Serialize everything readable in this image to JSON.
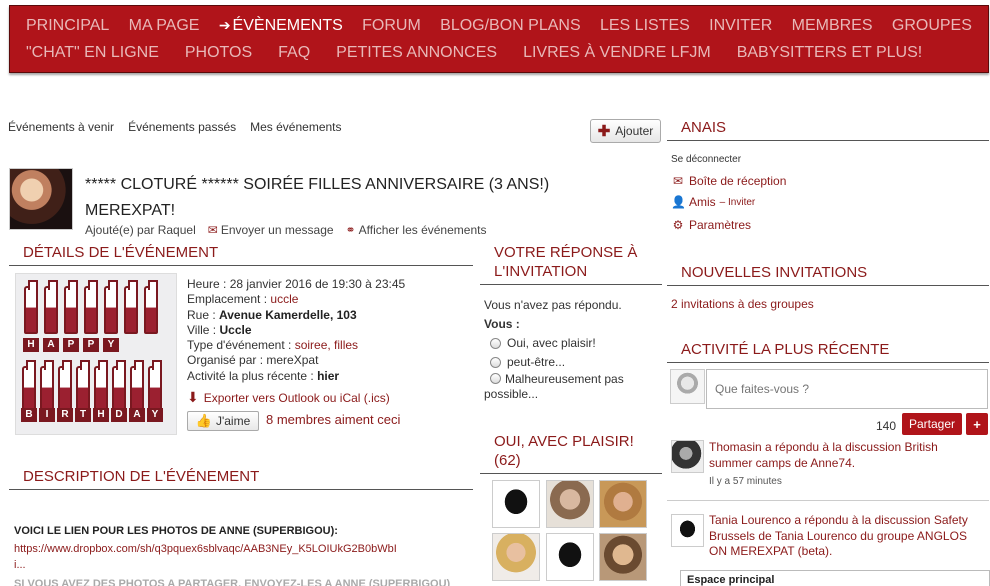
{
  "nav": {
    "row1": [
      {
        "label": "PRINCIPAL",
        "active": false
      },
      {
        "label": "MA PAGE",
        "active": false
      },
      {
        "label": "ÉVÈNEMENTS",
        "active": true
      },
      {
        "label": "FORUM",
        "active": false
      },
      {
        "label": "BLOG/BON PLANS",
        "active": false
      },
      {
        "label": "LES LISTES",
        "active": false
      },
      {
        "label": "INVITER",
        "active": false
      },
      {
        "label": "MEMBRES",
        "active": false
      },
      {
        "label": "GROUPES",
        "active": false
      }
    ],
    "row2": [
      {
        "label": "\"CHAT\" EN LIGNE"
      },
      {
        "label": "PHOTOS"
      },
      {
        "label": "FAQ"
      },
      {
        "label": "PETITES ANNONCES"
      },
      {
        "label": "LIVRES À VENDRE LFJM"
      },
      {
        "label": "BABYSITTERS ET PLUS!"
      }
    ]
  },
  "subnav": {
    "upcoming": "Événements à venir",
    "past": "Événements passés",
    "mine": "Mes événements",
    "add_label": "Ajouter"
  },
  "event": {
    "title": "***** CLOTURÉ ****** SOIRÉE FILLES ANNIVERSAIRE (3 ANS!) MEREXPAT!",
    "added_by_prefix": "Ajouté(e) par",
    "added_by": "Raquel",
    "send_message": "Envoyer un message",
    "show_events": "Afficher les événements"
  },
  "details": {
    "heading": "DÉTAILS DE L'ÉVÉNEMENT",
    "time_label": "Heure :",
    "time_value": "28 janvier 2016 de 19:30 à 23:45",
    "location_label": "Emplacement :",
    "location_value": "uccle",
    "street_label": "Rue :",
    "street_value": "Avenue Kamerdelle, 103",
    "city_label": "Ville :",
    "city_value": "Uccle",
    "type_label": "Type d'événement :",
    "type_value": "soiree, filles",
    "organizer_label": "Organisé par :",
    "organizer_value": "mereXpat",
    "recent_label": "Activité la plus récente :",
    "recent_value": "hier",
    "export": "Exporter vers Outlook ou iCal (.ics)",
    "like": "J'aime",
    "like_count": "8 membres aiment ceci",
    "image_letters": [
      "H",
      "A",
      "P",
      "P",
      "Y",
      "B",
      "I",
      "R",
      "T",
      "H",
      "D",
      "A",
      "Y"
    ]
  },
  "description": {
    "heading": "DESCRIPTION DE L'ÉVÉNEMENT",
    "strong": "VOICI LE LIEN POUR LES PHOTOS DE ANNE (SUPERBIGOU):",
    "link": "https://www.dropbox.com/sh/q3pquex6sblvaqc/AAB3NEy_K5LOIUkG2B0bWbI",
    "link_cont": "i...",
    "cut": "SI VOUS AVEZ DES PHOTOS A PARTAGER, ENVOYEZ-LES A ANNE (SUPERBIGOU)"
  },
  "rsvp": {
    "heading": "VOTRE RÉPONSE À L'INVITATION",
    "status": "Vous n'avez pas répondu.",
    "you_label": "Vous :",
    "options": [
      "Oui, avec plaisir!",
      "peut-être...",
      "Malheureusement pas possible..."
    ],
    "yes_heading": "OUI, AVEC PLAISIR! (62)"
  },
  "sidebar": {
    "user_heading": "ANAIS",
    "logout": "Se déconnecter",
    "inbox": "Boîte de réception",
    "friends": "Amis",
    "invite": "– Inviter",
    "settings": "Paramètres",
    "invites_heading": "NOUVELLES INVITATIONS",
    "invites_text": "2 invitations à des groupes",
    "activity_heading": "ACTIVITÉ LA PLUS RÉCENTE",
    "status_placeholder": "Que faites-vous ?",
    "char_count": "140",
    "share_label": "Partager",
    "plus_label": "+",
    "activity": [
      {
        "text": "Thomasin a répondu à la discussion British summer camps de Anne74.",
        "time": "Il y a 57 minutes"
      },
      {
        "text": "Tania Lourenco a répondu à la discussion Safety Brussels de Tania Lourenco du groupe ANGLOS ON MEREXPAT (beta).",
        "time": ""
      }
    ],
    "espace": "Espace principal"
  },
  "colors": {
    "brand": "#b0141a",
    "link": "#8b1a1a",
    "nav_text": "#e8b8b8"
  }
}
